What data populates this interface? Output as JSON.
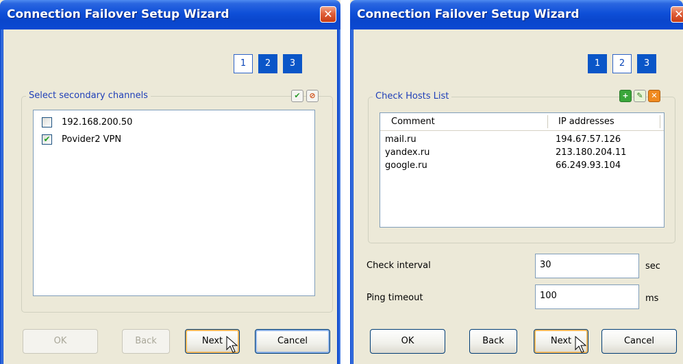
{
  "left": {
    "title": "Connection Failover Setup Wizard",
    "close": "✕",
    "steps": [
      "1",
      "2",
      "3"
    ],
    "group_title": "Select secondary channels",
    "items": [
      {
        "label": "192.168.200.50",
        "checked": false,
        "mark": ""
      },
      {
        "label": "Povider2 VPN",
        "checked": true,
        "mark": "✔"
      }
    ],
    "buttons": {
      "ok": "OK",
      "back": "Back",
      "next": "Next",
      "cancel": "Cancel"
    }
  },
  "right": {
    "title": "Connection Failover Setup Wizard",
    "close": "✕",
    "steps": [
      "1",
      "2",
      "3"
    ],
    "group_title": "Check Hosts List",
    "columns": [
      "Comment",
      "IP addresses"
    ],
    "rows": [
      {
        "comment": "mail.ru",
        "ip": "194.67.57.126"
      },
      {
        "comment": "yandex.ru",
        "ip": "213.180.204.11"
      },
      {
        "comment": "google.ru",
        "ip": "66.249.93.104"
      }
    ],
    "check_interval": {
      "label": "Check interval",
      "value": "30",
      "unit": "sec"
    },
    "ping_timeout": {
      "label": "Ping timeout",
      "value": "100",
      "unit": "ms"
    },
    "buttons": {
      "ok": "OK",
      "back": "Back",
      "next": "Next",
      "cancel": "Cancel"
    }
  },
  "icons": {
    "select_all": "✔",
    "deselect_all": "⊘",
    "add": "+",
    "edit": "✎",
    "delete": "✕"
  },
  "colors": {
    "title_bar": "#0a46cc",
    "step_active": "#0a56c8",
    "group_title": "#1f3fb8",
    "window_face": "#ece9d8",
    "close_button": "#e0603a"
  }
}
